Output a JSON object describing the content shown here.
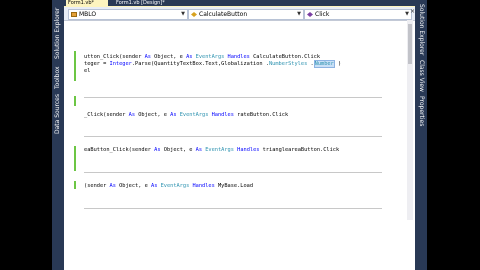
{
  "left_dock": {
    "tabs": [
      "Solution Explorer",
      "Toolbox",
      "Data Sources"
    ]
  },
  "right_dock": {
    "tabs": [
      "Solution Explorer",
      "Class View",
      "Properties"
    ]
  },
  "doc_tabs": [
    {
      "label": "Form1.vb*",
      "active": true
    },
    {
      "label": "Form1.vb [Design]*",
      "active": false
    }
  ],
  "navbar": {
    "class_combo": "MBLO",
    "object_combo": "CalculateButton",
    "event_combo": "Click"
  },
  "code": {
    "line1": "utton_Click(sender ",
    "line1_as": "As",
    "line1_obj": " Object, e ",
    "line1_as2": "As",
    "line1_ev": " EventArgs",
    "line1_handles": " Handles",
    "line1_rest": " CalculateButton.Click",
    "line2_a": "teger = ",
    "line2_ty": "Integer",
    "line2_b": ".Parse(QuantityTextBox.Text,Globalization .",
    "line2_c": "NumberStyles",
    "line2_d": " .",
    "line2_sel": "Number",
    "line2_e": " )",
    "line3": "el",
    "line4": "_Click(sender ",
    "line4_as": "As",
    "line4_obj": " Object, e ",
    "line4_as2": "As",
    "line4_ev": " EventArgs",
    "line4_handles": " Handles",
    "line4_rest": " rateButton.Click",
    "line5": "eaButton_Click(sender ",
    "line5_as": "As",
    "line5_obj": " Object, e ",
    "line5_as2": "As",
    "line5_ev": " EventArgs",
    "line5_handles": " Handles",
    "line5_rest": " triangleareaButton.Click",
    "line6": "(sender ",
    "line6_as": "As",
    "line6_obj": " Object, e ",
    "line6_as2": "As",
    "line6_ev": " EventArgs",
    "line6_handles": " Handles",
    "line6_rest": " MyBase.Load"
  },
  "colors": {
    "keyword": "#0000ff",
    "type": "#2b91af",
    "chrome": "#293955",
    "active_tab": "#fdf4bf",
    "change_marker": "#6cc644"
  }
}
